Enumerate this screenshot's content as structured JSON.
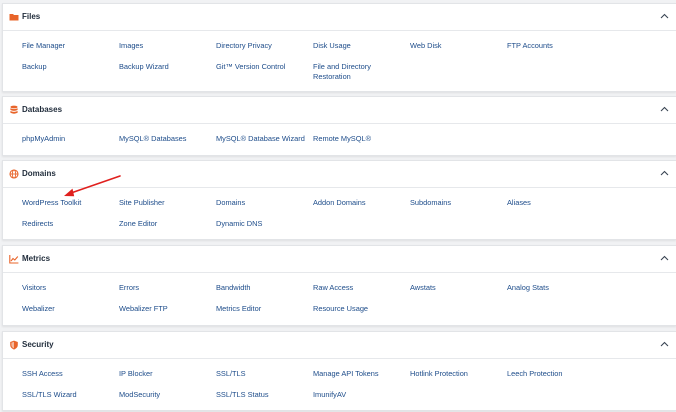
{
  "sections": [
    {
      "id": "files",
      "title": "Files",
      "icon": "folder-icon",
      "items": [
        "File Manager",
        "Images",
        "Directory Privacy",
        "Disk Usage",
        "Web Disk",
        "FTP Accounts",
        "Backup",
        "Backup Wizard",
        "Git™ Version Control",
        "File and Directory Restoration"
      ]
    },
    {
      "id": "databases",
      "title": "Databases",
      "icon": "database-icon",
      "items": [
        "phpMyAdmin",
        "MySQL® Databases",
        "MySQL® Database Wizard",
        "Remote MySQL®"
      ]
    },
    {
      "id": "domains",
      "title": "Domains",
      "icon": "globe-icon",
      "items": [
        "WordPress Toolkit",
        "Site Publisher",
        "Domains",
        "Addon Domains",
        "Subdomains",
        "Aliases",
        "Redirects",
        "Zone Editor",
        "Dynamic DNS"
      ]
    },
    {
      "id": "metrics",
      "title": "Metrics",
      "icon": "chart-icon",
      "items": [
        "Visitors",
        "Errors",
        "Bandwidth",
        "Raw Access",
        "Awstats",
        "Analog Stats",
        "Webalizer",
        "Webalizer FTP",
        "Metrics Editor",
        "Resource Usage"
      ]
    },
    {
      "id": "security",
      "title": "Security",
      "icon": "shield-icon",
      "items": [
        "SSH Access",
        "IP Blocker",
        "SSL/TLS",
        "Manage API Tokens",
        "Hotlink Protection",
        "Leech Protection",
        "SSL/TLS Wizard",
        "ModSecurity",
        "SSL/TLS Status",
        "ImunifyAV"
      ]
    }
  ],
  "colors": {
    "accent_icon": "#e8642a",
    "link": "#1d4c8a",
    "annotation_arrow": "#e0201e"
  }
}
